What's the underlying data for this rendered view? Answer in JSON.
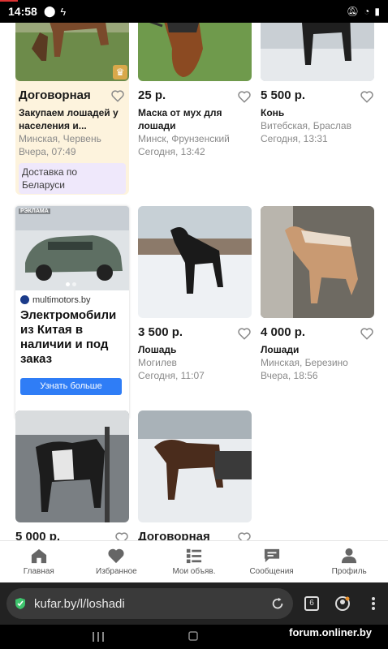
{
  "status_bar": {
    "time": "14:58"
  },
  "listings": [
    {
      "price": "Договорная",
      "title": "Закупаем лошадей у населения и...",
      "location": "Минская, Червень",
      "time": "Вчера, 07:49",
      "delivery": "Доставка по Беларуси",
      "premium": true
    },
    {
      "price": "25 р.",
      "title": "Маска от мух для лошади",
      "location": "Минск, Фрунзенский",
      "time": "Сегодня, 13:42"
    },
    {
      "price": "5 500 р.",
      "title": "Конь",
      "location": "Витебская, Браслав",
      "time": "Сегодня, 13:31"
    },
    {
      "price": "3 500 р.",
      "title": "Лошадь",
      "location": "Могилев",
      "time": "Сегодня, 11:07"
    },
    {
      "price": "4 000 р.",
      "title": "Лошади",
      "location": "Минская, Березино",
      "time": "Вчера, 18:56"
    },
    {
      "price": "5 000 р.",
      "title": "",
      "location": "",
      "time": ""
    },
    {
      "price": "Договорная",
      "title": "",
      "location": "",
      "time": ""
    }
  ],
  "ad": {
    "badge": "РЭКЛАМА",
    "source": "multimotors.by",
    "text": "Электромобили из Китая в наличии и под заказ",
    "button": "Узнать больше"
  },
  "bottom_nav": [
    {
      "label": "Главная",
      "icon": "home-icon"
    },
    {
      "label": "Избранное",
      "icon": "heart-icon"
    },
    {
      "label": "Мои объяв.",
      "icon": "list-icon"
    },
    {
      "label": "Сообщения",
      "icon": "chat-icon"
    },
    {
      "label": "Профиль",
      "icon": "profile-icon"
    }
  ],
  "browser": {
    "url": "kufar.by/l/loshadi",
    "tabs_count": "6"
  },
  "watermark": "forum.onliner.by"
}
